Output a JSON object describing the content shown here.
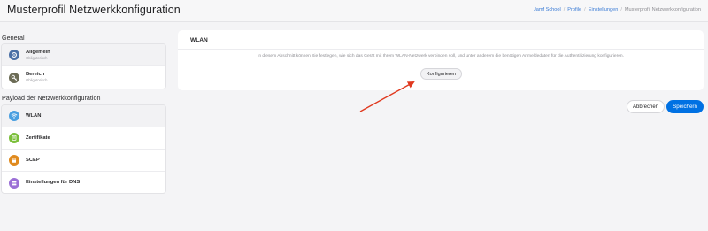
{
  "header": {
    "title": "Musterprofil Netzwerkkonfiguration",
    "breadcrumb": [
      "Jamf School",
      "Profile",
      "Einstellungen",
      "Musterprofil Netzwerkkonfiguration"
    ]
  },
  "sidebar": {
    "general_heading": "General",
    "general_items": [
      {
        "label": "Allgemein",
        "sub": "Obligatorisch",
        "icon": "gear-icon",
        "color": "#4a6fa5"
      },
      {
        "label": "Bereich",
        "sub": "Obligatorisch",
        "icon": "key-icon",
        "color": "#6b6b55"
      }
    ],
    "payload_heading": "Payload der Netzwerkkonfiguration",
    "payload_items": [
      {
        "label": "WLAN",
        "icon": "wifi-icon",
        "color": "#4a9fe0"
      },
      {
        "label": "Zertifikate",
        "icon": "certificate-icon",
        "color": "#7bbf3a"
      },
      {
        "label": "SCEP",
        "icon": "lock-icon",
        "color": "#e08a1e"
      },
      {
        "label": "Einstellungen für DNS",
        "icon": "dns-icon",
        "color": "#9b6fd6"
      }
    ]
  },
  "main": {
    "title": "WLAN",
    "description": "In diesem Abschnitt können Sie festlegen, wie sich das Gerät mit Ihrem WLAN-Netzwerk verbinden soll, und unter anderem die benötigen Anmeldedaten für die Authentifizierung konfigurieren.",
    "configure_label": "Konfigurieren"
  },
  "footer": {
    "cancel_label": "Abbrechen",
    "save_label": "Speichern"
  },
  "colors": {
    "accent": "#0071e3",
    "annotation_arrow": "#e0391f"
  }
}
